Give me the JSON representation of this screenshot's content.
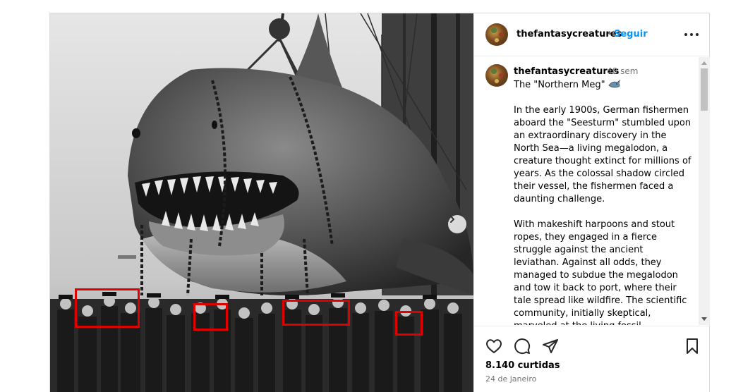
{
  "post": {
    "author": "thefantasycreatures",
    "separator": "•",
    "follow_label": "Seguir",
    "caption_author": "thefantasycreatures",
    "caption_time": "48 sem",
    "caption_title": "The \"Northern Meg\"",
    "caption_paragraphs": [
      "In the early 1900s, German fishermen aboard the \"Seesturm\" stumbled upon an extraordinary discovery in the North Sea—a living megalodon, a creature thought extinct for millions of years. As the colossal shadow circled their vessel, the fishermen faced a daunting challenge.",
      "With makeshift harpoons and stout ropes, they engaged in a fierce struggle against the ancient leviathan. Against all odds, they managed to subdue the megalodon and tow it back to port, where their tale spread like wildfire. The scientific community, initially skeptical, marveled at the living fossil."
    ],
    "likes": "8.140 curtidas",
    "date": "24 de janeiro"
  },
  "icons": {
    "like": "heart-icon",
    "comment": "comment-icon",
    "share": "send-icon",
    "save": "bookmark-icon",
    "more": "more-options-icon",
    "next": "chevron-right-icon",
    "emoji": "shark-emoji"
  },
  "colors": {
    "follow_blue": "#0095f6",
    "highlight_red": "#e00000",
    "muted_text": "#737373",
    "border": "#dbdbdb"
  }
}
